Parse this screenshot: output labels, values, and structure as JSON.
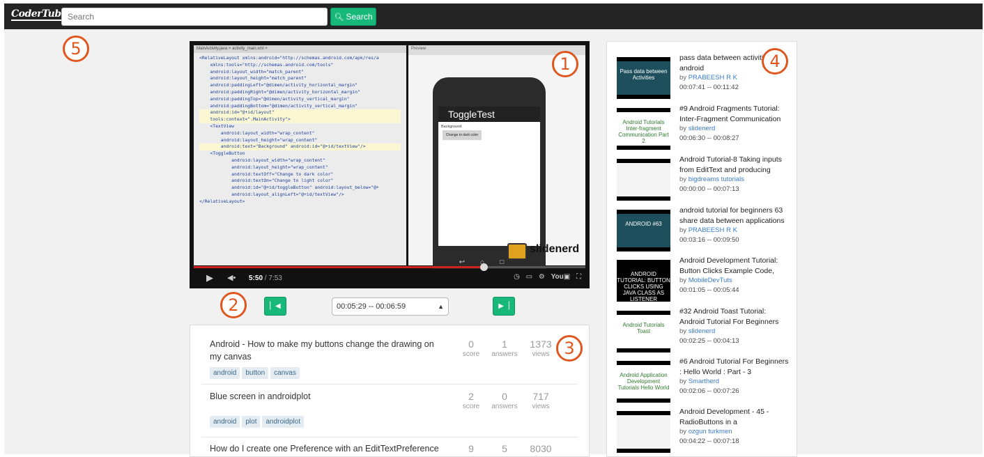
{
  "navbar": {
    "logo": "CoderTube",
    "search_placeholder": "Search",
    "search_button": "Search"
  },
  "markers": [
    "1",
    "2",
    "3",
    "4",
    "5"
  ],
  "video": {
    "ide_tabs": "MainActivity.java ×   activity_main.xml ×",
    "preview_label": "Preview",
    "app_title": "ToggleTest",
    "app_label": "Background",
    "app_button": "Change to dark color",
    "watermark": "slidenerd",
    "current_time": "5:50",
    "duration": " / 7:53",
    "progress": 0.74,
    "code": [
      "<RelativeLayout xmlns:android=\"http://schemas.android.com/apk/res/a",
      "    xmlns:tools=\"http://schemas.android.com/tools\"",
      "    android:layout_width=\"match_parent\"",
      "    android:layout_height=\"match_parent\"",
      "    android:paddingLeft=\"@dimen/activity_horizontal_margin\"",
      "    android:paddingRight=\"@dimen/activity_horizontal_margin\"",
      "    android:paddingTop=\"@dimen/activity_vertical_margin\"",
      "    android:paddingBottom=\"@dimen/activity_vertical_margin\"",
      "    android:id=\"@+id/layout\"",
      "    tools:context=\".MainActivity\">",
      "",
      "    <TextView",
      "        android:layout_width=\"wrap_content\"",
      "        android:layout_height=\"wrap_content\"",
      "        android:text=\"Background\" android:id=\"@+id/textView\"/>",
      "    <ToggleButton",
      "            android:layout_width=\"wrap_content\"",
      "            android:layout_height=\"wrap_content\"",
      "            android:textOff=\"Change to dark color\"",
      "            android:textOn=\"Change to light color\"",
      "            android:id=\"@+id/toggleButton\" android:layout_below=\"@+",
      "            android:layout_alignLeft=\"@+id/textView\"/>",
      "",
      "",
      "</RelativeLayout>"
    ]
  },
  "segment": {
    "prev_icon": "skip-back-icon",
    "next_icon": "skip-forward-icon",
    "selected": "00:05:29 -- 00:06:59"
  },
  "questions": [
    {
      "title": "Android - How to make my buttons change the drawing on my canvas",
      "tags": [
        "android",
        "button",
        "canvas"
      ],
      "score": "0",
      "answers": "1",
      "views": "1373"
    },
    {
      "title": "Blue screen in androidplot",
      "tags": [
        "android",
        "plot",
        "androidplot"
      ],
      "score": "2",
      "answers": "0",
      "views": "717"
    },
    {
      "title": "How do I create one Preference with an EditTextPreference",
      "tags": [],
      "score": "9",
      "answers": "5",
      "views": "8030"
    }
  ],
  "question_labels": {
    "score": "score",
    "answers": "answers",
    "views": "views"
  },
  "related": [
    {
      "title": "pass data between activities in android",
      "by": "by ",
      "channel": "PRABEESH R K",
      "time": "00:07:41 -- 00:11:42",
      "thumb_text": "Pass data between Activities",
      "thumb_bg": "#1d4f5c"
    },
    {
      "title": "#9 Android Fragments Tutorial: Inter-Fragment Communication",
      "by": "by ",
      "channel": "slidenerd",
      "time": "00:06:30 -- 00:08:27",
      "thumb_text": "Android Tutorials Inter-fragment Communication Part 2",
      "thumb_bg": "#ffffff"
    },
    {
      "title": "Android Tutorial-8 Taking inputs from EditText and producing",
      "by": "by ",
      "channel": "bigdreams tutorials",
      "time": "00:00:00 -- 00:07:13",
      "thumb_text": "",
      "thumb_bg": "#f4f4f4"
    },
    {
      "title": "android tutorial for beginners 63 share data between applications",
      "by": "by ",
      "channel": "PRABEESH R K",
      "time": "00:03:16 -- 00:09:50",
      "thumb_text": "ANDROID #63",
      "thumb_bg": "#1d4f5c"
    },
    {
      "title": "Android Development Tutorial: Button Clicks Example Code,",
      "by": "by ",
      "channel": "MobileDevTuts",
      "time": "00:01:05 -- 00:05:44",
      "thumb_text": "ANDROID TUTORIAL: BUTTON CLICKS USING JAVA CLASS AS LISTENER",
      "thumb_bg": "#000000"
    },
    {
      "title": "#32 Android Toast Tutorial: Android Tutorial For Beginners",
      "by": "by ",
      "channel": "slidenerd",
      "time": "00:02:25 -- 00:04:13",
      "thumb_text": "Android Tutorials Toast",
      "thumb_bg": "#ffffff"
    },
    {
      "title": "#6 Android Tutorial For Beginners : Hello World : Part - 3",
      "by": "by ",
      "channel": "Smartherd",
      "time": "00:02:06 -- 00:07:26",
      "thumb_text": "Android Application Development Tutorials Hello World",
      "thumb_bg": "#ffffff"
    },
    {
      "title": "Android Development - 45 - RadioButtons in a",
      "by": "by ",
      "channel": "ozgun turkmen",
      "time": "00:04:22 -- 00:07:18",
      "thumb_text": "",
      "thumb_bg": "#f4f4f4"
    }
  ],
  "colors": {
    "accent": "#18b87a",
    "marker": "#e0561f",
    "navbar": "#242424",
    "link": "#3a7bc8"
  }
}
